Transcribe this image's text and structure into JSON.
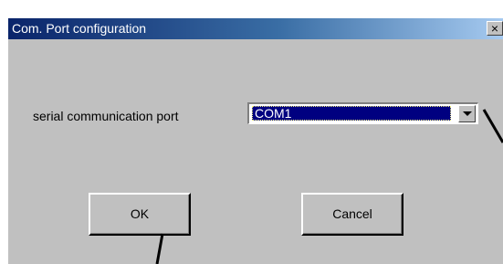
{
  "window": {
    "title": "Com. Port configuration",
    "close_glyph": "×",
    "close_icon": "close-icon"
  },
  "form": {
    "port_label": "serial communication port",
    "port_value": "COM1",
    "dropdown_icon": "chevron-down-icon"
  },
  "buttons": {
    "ok_label": "OK",
    "cancel_label": "Cancel"
  },
  "colors": {
    "titlebar_start": "#0a246a",
    "titlebar_end": "#a6caf0",
    "face": "#c0c0c0",
    "selection": "#000080"
  }
}
